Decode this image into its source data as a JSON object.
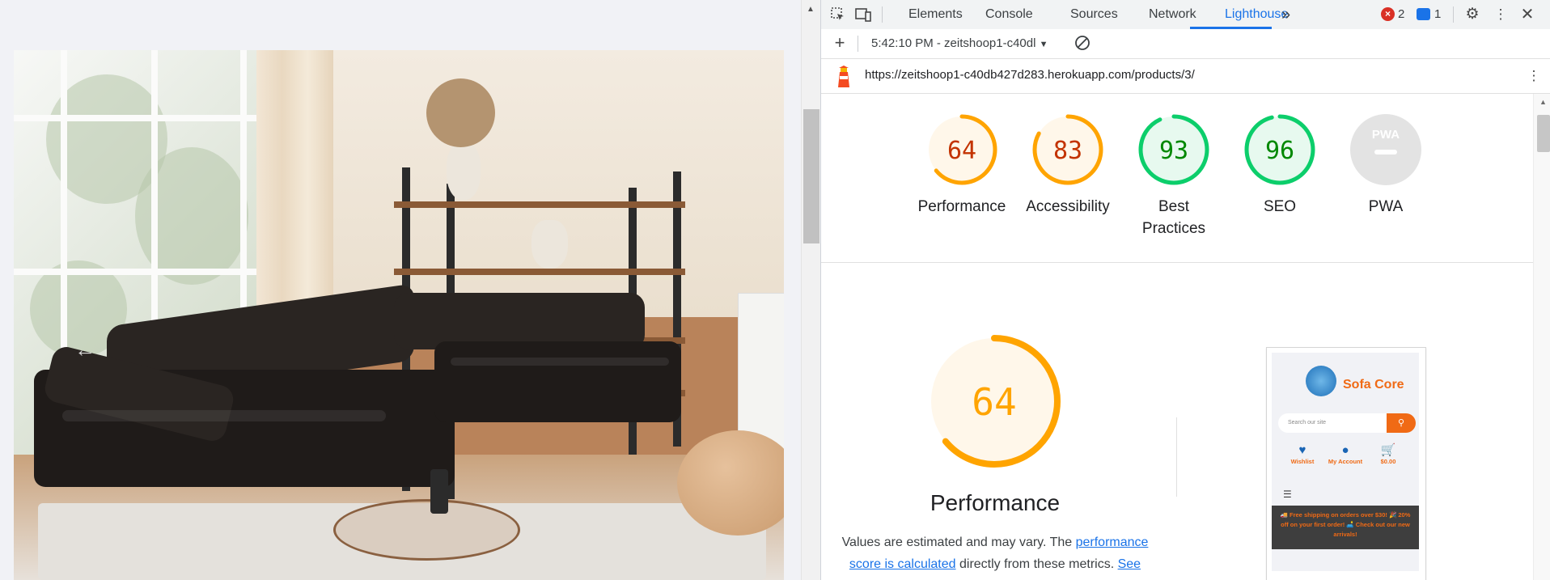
{
  "devtools": {
    "tabs": [
      "Elements",
      "Console",
      "Sources",
      "Network",
      "Lighthouse"
    ],
    "active_tab": "Lighthouse",
    "more_tabs_glyph": "»",
    "error_count": "2",
    "message_count": "1",
    "report_selector": "5:42:10 PM - zeitshoop1-c40dl",
    "report_url": "https://zeitshoop1-c40db427d283.herokuapp.com/products/3/"
  },
  "scores": [
    {
      "label": "Performance",
      "value": "64",
      "color": "#ffa400"
    },
    {
      "label": "Accessibility",
      "value": "83",
      "color": "#ffa400"
    },
    {
      "label": "Best Practices",
      "value": "93",
      "color": "#0cce6b"
    },
    {
      "label": "SEO",
      "value": "96",
      "color": "#0cce6b"
    },
    {
      "label": "PWA",
      "value": "PWA",
      "color": "#cccccc"
    }
  ],
  "performance_section": {
    "score": "64",
    "title": "Performance",
    "desc_prefix": "Values are estimated and may vary. The ",
    "desc_link": "performance score is calculated",
    "desc_middle": " directly from these metrics. ",
    "desc_link2": "See"
  },
  "preview": {
    "brand": "Sofa Core",
    "search_placeholder": "Search our site",
    "wishlist": "Wishlist",
    "account": "My Account",
    "cart": "$0.00",
    "banner": "🚚 Free shipping on orders over $30! 🎉 20% off on your first order! 🛋️ Check out our new arrivals!"
  }
}
